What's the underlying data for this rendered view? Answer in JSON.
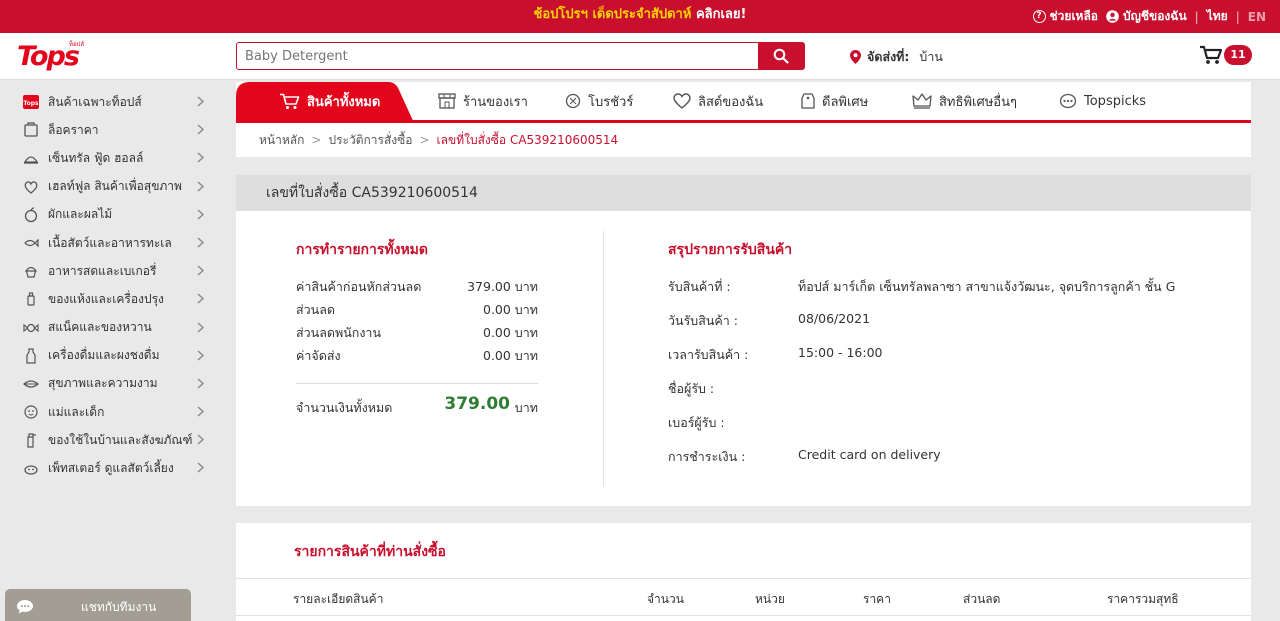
{
  "promo": {
    "highlight": "ช้อปโปรฯ เด็ดประจำสัปดาห์",
    "cta": "คลิกเลย!"
  },
  "top_links": {
    "help": "ช่วยเหลือ",
    "account": "บัญชีของฉัน",
    "lang_th": "ไทย",
    "lang_en": "EN",
    "separator": "|"
  },
  "logo": {
    "text": "Tops",
    "tagline": "ท็อปส์"
  },
  "search": {
    "placeholder": "Baby Detergent"
  },
  "delivery": {
    "label": "จัดส่งที่:",
    "value": "บ้าน"
  },
  "cart": {
    "count": "11"
  },
  "sidebar": {
    "items": [
      {
        "label": "สินค้าเฉพาะท็อปส์"
      },
      {
        "label": "ล็อคราคา"
      },
      {
        "label": "เซ็นทรัล ฟู้ด ฮอลล์"
      },
      {
        "label": "เฮลท์ฟูล สินค้าเพื่อสุขภาพ"
      },
      {
        "label": "ผักและผลไม้"
      },
      {
        "label": "เนื้อสัตว์และอาหารทะเล"
      },
      {
        "label": "อาหารสดและเบเกอรี่"
      },
      {
        "label": "ของแห้งและเครื่องปรุง"
      },
      {
        "label": "สแน็คและของหวาน"
      },
      {
        "label": "เครื่องดื่มและผงชงดื่ม"
      },
      {
        "label": "สุขภาพและความงาม"
      },
      {
        "label": "แม่และเด็ก"
      },
      {
        "label": "ของใช้ในบ้านและสังฆภัณฑ์"
      },
      {
        "label": "เพ็ทสเตอร์ ดูแลสัตว์เลี้ยง"
      }
    ]
  },
  "chat": {
    "label": "แชทกับทีมงาน"
  },
  "nav": {
    "tabs": [
      {
        "label": "สินค้าทั้งหมด"
      },
      {
        "label": "ร้านของเรา"
      },
      {
        "label": "โบรชัวร์"
      },
      {
        "label": "ลิสต์ของฉัน"
      },
      {
        "label": "ดีลพิเศษ"
      },
      {
        "label": "สิทธิพิเศษอื่นๆ"
      },
      {
        "label": "Topspicks"
      }
    ]
  },
  "breadcrumb": {
    "home": "หน้าหลัก",
    "history": "ประวัติการสั่งซื้อ",
    "current": "เลขที่ใบสั่งซื้อ CA539210600514",
    "sep": ">"
  },
  "order": {
    "title": "เลขที่ใบสั่งซื้อ CA539210600514",
    "summary_title": "การทำรายการทั้งหมด",
    "rows": [
      {
        "label": "ค่าสินค้าก่อนหักส่วนลด",
        "value": "379.00 บาท"
      },
      {
        "label": "ส่วนลด",
        "value": "0.00 บาท"
      },
      {
        "label": "ส่วนลดพนักงาน",
        "value": "0.00 บาท"
      },
      {
        "label": "ค่าจัดส่ง",
        "value": "0.00 บาท"
      }
    ],
    "total_label": "จำนวนเงินทั้งหมด",
    "total_value": "379.00",
    "total_unit": "บาท",
    "pickup_title": "สรุปรายการรับสินค้า",
    "pickup": [
      {
        "label": "รับสินค้าที่ :",
        "value": "ท็อปส์ มาร์เก็ต เซ็นทรัลพลาซา สาขาแจ้งวัฒนะ, จุดบริการลูกค้า ชั้น G"
      },
      {
        "label": "วันรับสินค้า :",
        "value": "08/06/2021"
      },
      {
        "label": "เวลารับสินค้า :",
        "value": "15:00 - 16:00"
      },
      {
        "label": "ชื่อผู้รับ :",
        "value": ""
      },
      {
        "label": "เบอร์ผู้รับ :",
        "value": ""
      },
      {
        "label": "การชำระเงิน :",
        "value": "Credit card on delivery"
      }
    ]
  },
  "items": {
    "title": "รายการสินค้าที่ท่านสั่งซื้อ",
    "columns": [
      "รายละเอียดสินค้า",
      "จำนวน",
      "หน่วย",
      "ราคา",
      "ส่วนลด",
      "ราคารวมสุทธิ"
    ]
  },
  "colors": {
    "brand_red": "#c8102e",
    "promo_yellow": "#ffd200",
    "total_green": "#2e7d32"
  }
}
